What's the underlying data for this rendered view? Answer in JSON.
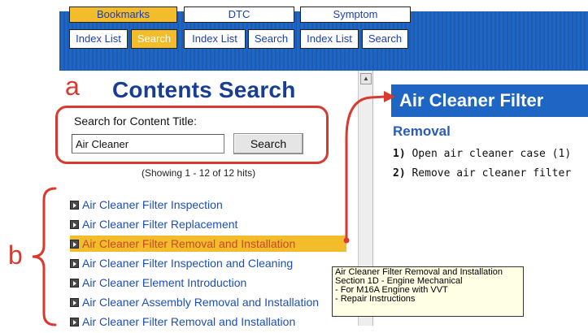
{
  "nav": {
    "tabs": [
      {
        "label": "Bookmarks",
        "active": true
      },
      {
        "label": "DTC",
        "active": false
      },
      {
        "label": "Symptom",
        "active": false
      }
    ],
    "subtabs": [
      {
        "label": "Index List",
        "active": false
      },
      {
        "label": "Search",
        "active": true
      },
      {
        "label": "Index List",
        "active": false
      },
      {
        "label": "Search",
        "active": false
      },
      {
        "label": "Index List",
        "active": false
      },
      {
        "label": "Search",
        "active": false
      }
    ]
  },
  "annotations": {
    "a": "a",
    "b": "b"
  },
  "search": {
    "title": "Contents Search",
    "label": "Search for Content Title:",
    "value": "Air Cleaner",
    "button": "Search",
    "hits": "(Showing 1 - 12 of 12 hits)"
  },
  "results": [
    {
      "label": "Air Cleaner Filter Inspection",
      "highlighted": false
    },
    {
      "label": "Air Cleaner Filter Replacement",
      "highlighted": false
    },
    {
      "label": "Air Cleaner Filter Removal and Installation",
      "highlighted": true
    },
    {
      "label": "Air Cleaner Filter Inspection and Cleaning",
      "highlighted": false
    },
    {
      "label": "Air Cleaner Element Introduction",
      "highlighted": false
    },
    {
      "label": "Air Cleaner Assembly Removal and Installation",
      "highlighted": false
    },
    {
      "label": "Air Cleaner Filter Removal and Installation",
      "highlighted": false
    }
  ],
  "tooltip": {
    "lines": [
      "Air Cleaner Filter Removal and Installation",
      "Section 1D - Engine Mechanical",
      "- For M16A Engine with VVT",
      "- Repair Instructions"
    ]
  },
  "content": {
    "title": "Air Cleaner Filter",
    "section": "Removal",
    "steps": [
      {
        "num": "1)",
        "text": "Open air cleaner case (1)"
      },
      {
        "num": "2)",
        "text": "Remove air cleaner filter"
      }
    ]
  },
  "colors": {
    "nav_bg": "#1f66c4",
    "active_tab": "#f3bc2a",
    "annotation_red": "#d83a2f",
    "title_blue": "#183e93",
    "link_blue": "#1c4fb8"
  }
}
